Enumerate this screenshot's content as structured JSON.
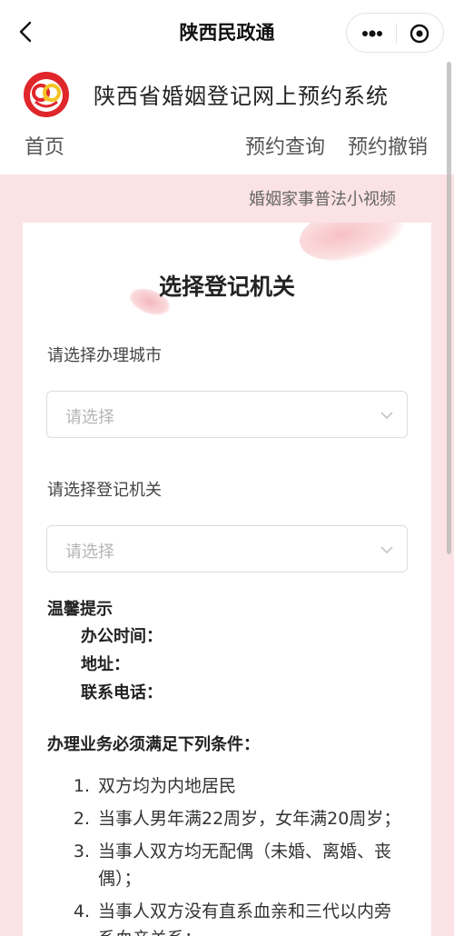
{
  "miniprogram": {
    "title": "陕西民政通"
  },
  "header": {
    "system_title": "陕西省婚姻登记网上预约系统",
    "nav": {
      "home": "首页",
      "query": "预约查询",
      "cancel": "预约撤销"
    }
  },
  "video_link": "婚姻家事普法小视频",
  "card": {
    "title": "选择登记机关",
    "city": {
      "label": "请选择办理城市",
      "placeholder": "请选择"
    },
    "office": {
      "label": "请选择登记机关",
      "placeholder": "请选择"
    },
    "tips": {
      "title": "温馨提示",
      "hours": "办公时间：",
      "address": "地址：",
      "phone": "联系电话："
    },
    "conditions": {
      "title": "办理业务必须满足下列条件：",
      "items": [
        {
          "num": "1.",
          "text": "双方均为内地居民"
        },
        {
          "num": "2.",
          "text": "当事人男年满22周岁，女年满20周岁；"
        },
        {
          "num": "3.",
          "text": "当事人双方均无配偶（未婚、离婚、丧偶）；"
        },
        {
          "num": "4.",
          "text": "当事人双方没有直系血亲和三代以内旁系血亲关系；"
        }
      ]
    }
  },
  "colors": {
    "page_bg": "#fbe2e4",
    "logo_red": "#e0262b",
    "logo_yellow": "#f4c324"
  },
  "icons": [
    "back-icon",
    "more-icon",
    "close-circle-icon",
    "chevron-down-icon",
    "logo-emblem"
  ]
}
